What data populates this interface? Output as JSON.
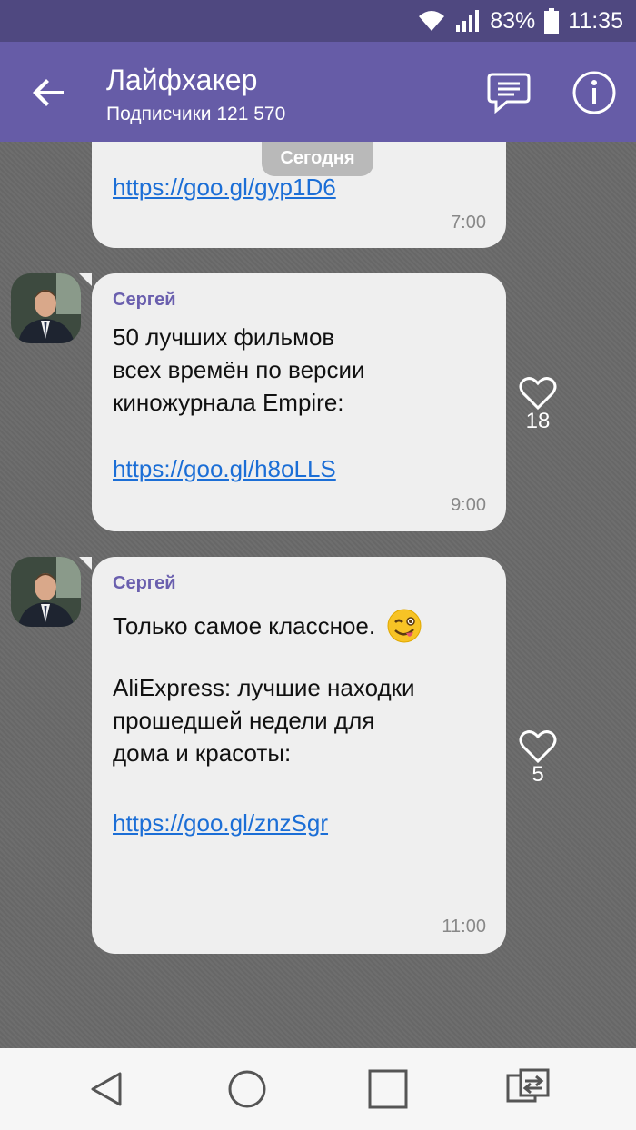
{
  "status_bar": {
    "battery": "83%",
    "time": "11:35"
  },
  "header": {
    "title": "Лайфхакер",
    "subtitle": "Подписчики 121 570"
  },
  "chat": {
    "date_label": "Сегодня",
    "messages": [
      {
        "link": "https://goo.gl/gyp1D6",
        "time": "7:00"
      },
      {
        "sender": "Сергей",
        "text": "50 лучших фильмов\nвсех времён по версии\nкиножурнала Empire:",
        "link": "https://goo.gl/h8oLLS",
        "time": "9:00",
        "likes": "18"
      },
      {
        "sender": "Сергей",
        "text": "Только самое классное.",
        "text2": "AliExpress: лучшие находки\nпрошедшей недели для\nдома и красоты:",
        "link": "https://goo.gl/znzSgr",
        "time": "11:00",
        "likes": "5"
      }
    ]
  },
  "colors": {
    "appbar": "#665ca7",
    "statusbar": "#4f4880",
    "sender": "#6a5fae",
    "link": "#1b6ed6"
  },
  "icons": [
    "wifi-icon",
    "signal-icon",
    "battery-icon",
    "back-arrow-icon",
    "chat-icon",
    "info-icon",
    "heart-icon",
    "wink-emoji-icon",
    "nav-back-icon",
    "nav-home-icon",
    "nav-recents-icon",
    "nav-switch-icon"
  ]
}
